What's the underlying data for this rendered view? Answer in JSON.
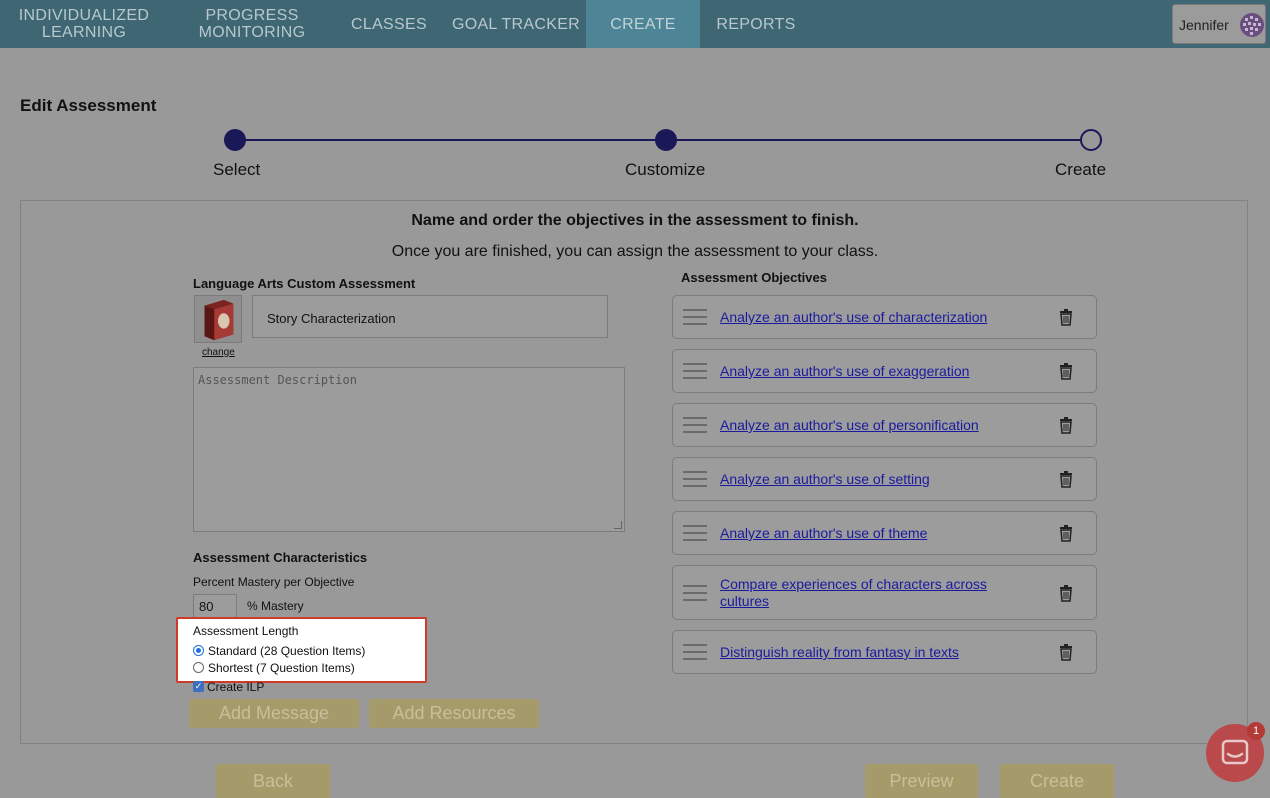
{
  "nav": {
    "items": [
      {
        "line1": "INDIVIDUALIZED",
        "line2": "LEARNING"
      },
      {
        "line1": "PROGRESS",
        "line2": "MONITORING"
      },
      {
        "line1": "CLASSES"
      },
      {
        "line1": "GOAL TRACKER"
      },
      {
        "line1": "CREATE",
        "active": true
      },
      {
        "line1": "REPORTS"
      }
    ],
    "user_name": "Jennifer"
  },
  "page_title": "Edit Assessment",
  "stepper": {
    "steps": [
      "Select",
      "Customize",
      "Create"
    ],
    "current_step": 2
  },
  "panel": {
    "headline": "Name and order the objectives in the assessment to finish.",
    "subline": "Once you are finished, you can assign the assessment to your class."
  },
  "form": {
    "section_title": "Language Arts Custom Assessment",
    "name_value": "Story Characterization",
    "change_link": "change",
    "description_placeholder": "Assessment Description",
    "characteristics_title": "Assessment Characteristics",
    "mastery_label": "Percent Mastery per Objective",
    "mastery_value": "80",
    "mastery_suffix": "% Mastery",
    "length_label": "Assessment Length",
    "length_options": [
      "Standard (28 Question Items)",
      "Shortest (7 Question Items)"
    ],
    "length_selected": 0,
    "create_ilp_label": "Create ILP",
    "create_ilp_checked": true,
    "add_message_button": "Add Message",
    "add_resources_button": "Add Resources"
  },
  "objectives": {
    "title": "Assessment Objectives",
    "items": [
      "Analyze an author's use of characterization",
      "Analyze an author's use of exaggeration",
      "Analyze an author's use of personification",
      "Analyze an author's use of setting",
      "Analyze an author's use of theme",
      "Compare experiences of characters across cultures",
      "Distinguish reality from fantasy in texts"
    ]
  },
  "footer": {
    "back_button": "Back",
    "preview_button": "Preview",
    "create_button": "Create"
  },
  "chat": {
    "badge_count": "1"
  },
  "colors": {
    "nav_bg": "#3e6773",
    "nav_active": "#4d8597",
    "step_color": "#1a1856",
    "link": "#1a1a9e",
    "button_gold": "#a59a6a",
    "highlight_border": "#d03a2b"
  }
}
